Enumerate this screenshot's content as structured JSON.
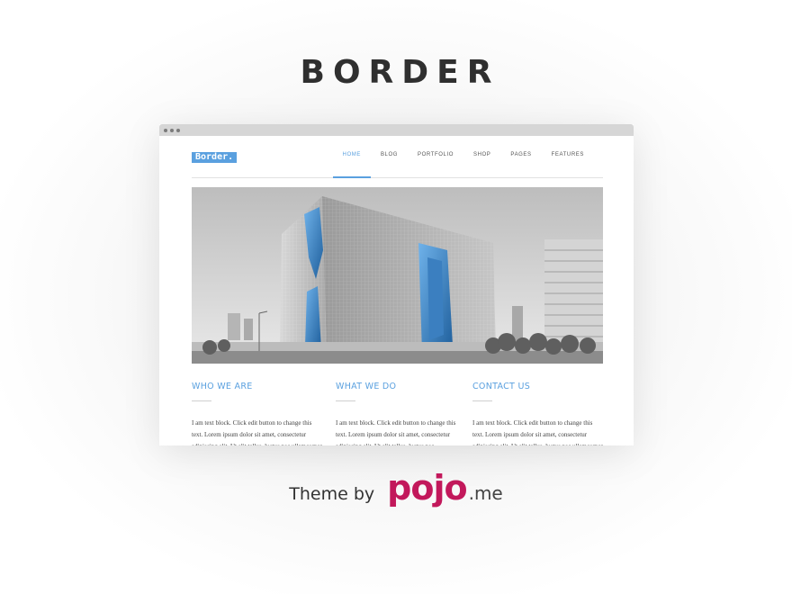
{
  "theme_title": "BORDER",
  "site": {
    "logo": "Border.",
    "nav": [
      "HOME",
      "BLOG",
      "PORTFOLIO",
      "SHOP",
      "PAGES",
      "FEATURES"
    ],
    "active_nav": "HOME"
  },
  "columns": [
    {
      "title": "WHO WE ARE",
      "text": "I am text block. Click edit button to change this text. Lorem ipsum dolor sit amet, consectetur adipiscing elit. Ut elit tellus, luctus nec ullamcorper mattis,"
    },
    {
      "title": "WHAT WE DO",
      "text": "I am text block. Click edit button to change this text. Lorem ipsum dolor sit amet, consectetur adipiscing elit. Ut elit tellus, luctus nec"
    },
    {
      "title": "CONTACT US",
      "text": "I am text block. Click edit button to change this text. Lorem ipsum dolor sit amet, consectetur adipiscing elit. Ut elit tellus, luctus nec ullamcorper mattis,"
    }
  ],
  "byline": {
    "text": "Theme by",
    "brand": "pojo",
    "suffix": ".me"
  },
  "colors": {
    "accent": "#5aa0df",
    "brand": "#c2185b"
  }
}
